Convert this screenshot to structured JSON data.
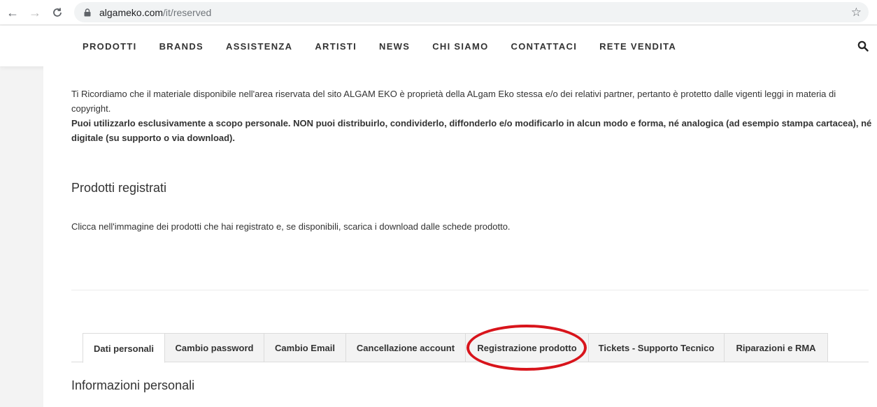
{
  "browser": {
    "url_host": "algameko.com",
    "url_path": "/it/reserved"
  },
  "menu": {
    "items": [
      "PRODOTTI",
      "BRANDS",
      "ASSISTENZA",
      "ARTISTI",
      "NEWS",
      "CHI SIAMO",
      "CONTATTACI",
      "RETE VENDITA"
    ]
  },
  "notice": {
    "text": "Ti Ricordiamo che il materiale disponibile nell'area riservata del sito ALGAM EKO è proprietà della ALgam Eko stessa e/o dei relativi partner, pertanto è protetto dalle vigenti leggi in materia di copyright.",
    "strong_text": "Puoi utilizzarlo esclusivamente a scopo personale. NON puoi distribuirlo, condividerlo, diffonderlo e/o modificarlo in alcun modo e forma, né analogica (ad esempio stampa cartacea), né digitale (su supporto o via download)."
  },
  "registered": {
    "title": "Prodotti registrati",
    "description": "Clicca nell'immagine dei prodotti che hai registrato e, se disponibili, scarica i download dalle schede prodotto."
  },
  "tabs": {
    "items": [
      "Dati personali",
      "Cambio password",
      "Cambio Email",
      "Cancellazione account",
      "Registrazione prodotto",
      "Tickets - Supporto Tecnico",
      "Riparazioni e RMA"
    ],
    "active": "Dati personali"
  },
  "personal": {
    "title": "Informazioni personali"
  },
  "colors": {
    "highlight": "#d8141b"
  }
}
